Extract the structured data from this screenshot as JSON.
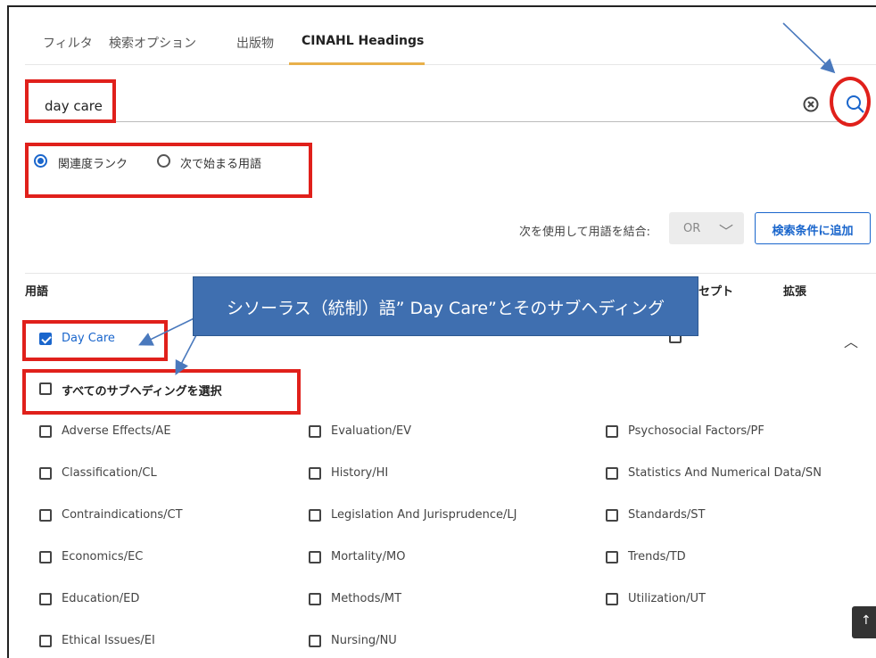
{
  "tabs": [
    {
      "label": "フィルタ"
    },
    {
      "label": "検索オプション"
    },
    {
      "label": "出版物"
    },
    {
      "label": "CINAHL Headings"
    }
  ],
  "search": {
    "value": "day care"
  },
  "radios": [
    {
      "label": "関連度ランク",
      "selected": true
    },
    {
      "label": "次で始まる用語",
      "selected": false
    }
  ],
  "combine": {
    "label": "次を使用して用語を結合:",
    "operator": "OR",
    "add_button": "検索条件に追加"
  },
  "table": {
    "col_term": "用語",
    "col_concept": "セプト",
    "col_expand": "拡張"
  },
  "main_term": {
    "label": "Day Care",
    "checked": true
  },
  "select_all": {
    "label": "すべてのサブヘディングを選択"
  },
  "subheadings": [
    [
      "Adverse Effects/AE",
      "Evaluation/EV",
      "Psychosocial Factors/PF"
    ],
    [
      "Classification/CL",
      "History/HI",
      "Statistics And Numerical Data/SN"
    ],
    [
      "Contraindications/CT",
      "Legislation And Jurisprudence/LJ",
      "Standards/ST"
    ],
    [
      "Economics/EC",
      "Mortality/MO",
      "Trends/TD"
    ],
    [
      "Education/ED",
      "Methods/MT",
      "Utilization/UT"
    ],
    [
      "Ethical Issues/EI",
      "Nursing/NU",
      ""
    ]
  ],
  "annotation": {
    "text": "シソーラス（統制）語” Day Care”とそのサブヘディング"
  },
  "colors": {
    "accent": "#1a66cc",
    "tab_underline": "#e8b04a",
    "highlight": "#e0201b",
    "callout": "#3f6fb0"
  }
}
